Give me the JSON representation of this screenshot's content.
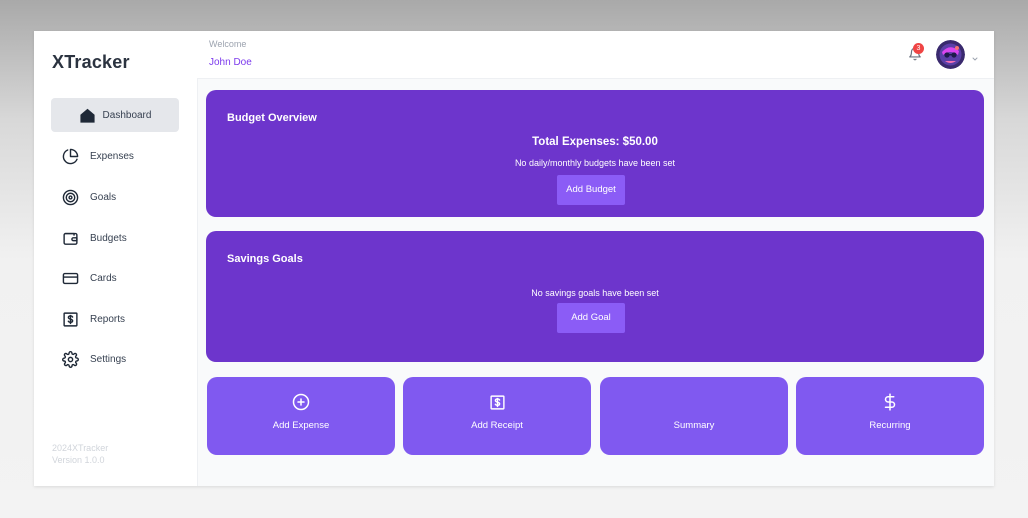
{
  "app": {
    "name": "XTracker"
  },
  "header": {
    "welcome": "Welcome",
    "username": "John Doe",
    "notification_count": "3"
  },
  "sidebar": {
    "items": [
      {
        "label": "Dashboard",
        "icon": "home-icon",
        "active": true
      },
      {
        "label": "Expenses",
        "icon": "pie-chart-icon"
      },
      {
        "label": "Goals",
        "icon": "target-icon"
      },
      {
        "label": "Budgets",
        "icon": "wallet-icon"
      },
      {
        "label": "Cards",
        "icon": "credit-card-icon"
      },
      {
        "label": "Reports",
        "icon": "dollar-receipt-icon"
      },
      {
        "label": "Settings",
        "icon": "gear-icon"
      }
    ],
    "footer": {
      "copyright": "2024XTracker",
      "version": "Version 1.0.0"
    }
  },
  "budget_overview": {
    "title": "Budget Overview",
    "total": "Total Expenses: $50.00",
    "message": "No daily/monthly budgets have been set",
    "button": "Add Budget"
  },
  "savings_goals": {
    "title": "Savings Goals",
    "message": "No savings goals have been set",
    "button": "Add Goal"
  },
  "quick_actions": [
    {
      "label": "Add Expense",
      "icon": "plus-circle-icon"
    },
    {
      "label": "Add Receipt",
      "icon": "receipt-icon"
    },
    {
      "label": "Summary",
      "icon": ""
    },
    {
      "label": "Recurring",
      "icon": "dollar-icon"
    }
  ],
  "colors": {
    "card": "#6d35cc",
    "tile": "#8059f0",
    "button": "#8b5cf6",
    "accent": "#7c3aed",
    "badge": "#ef4444"
  }
}
